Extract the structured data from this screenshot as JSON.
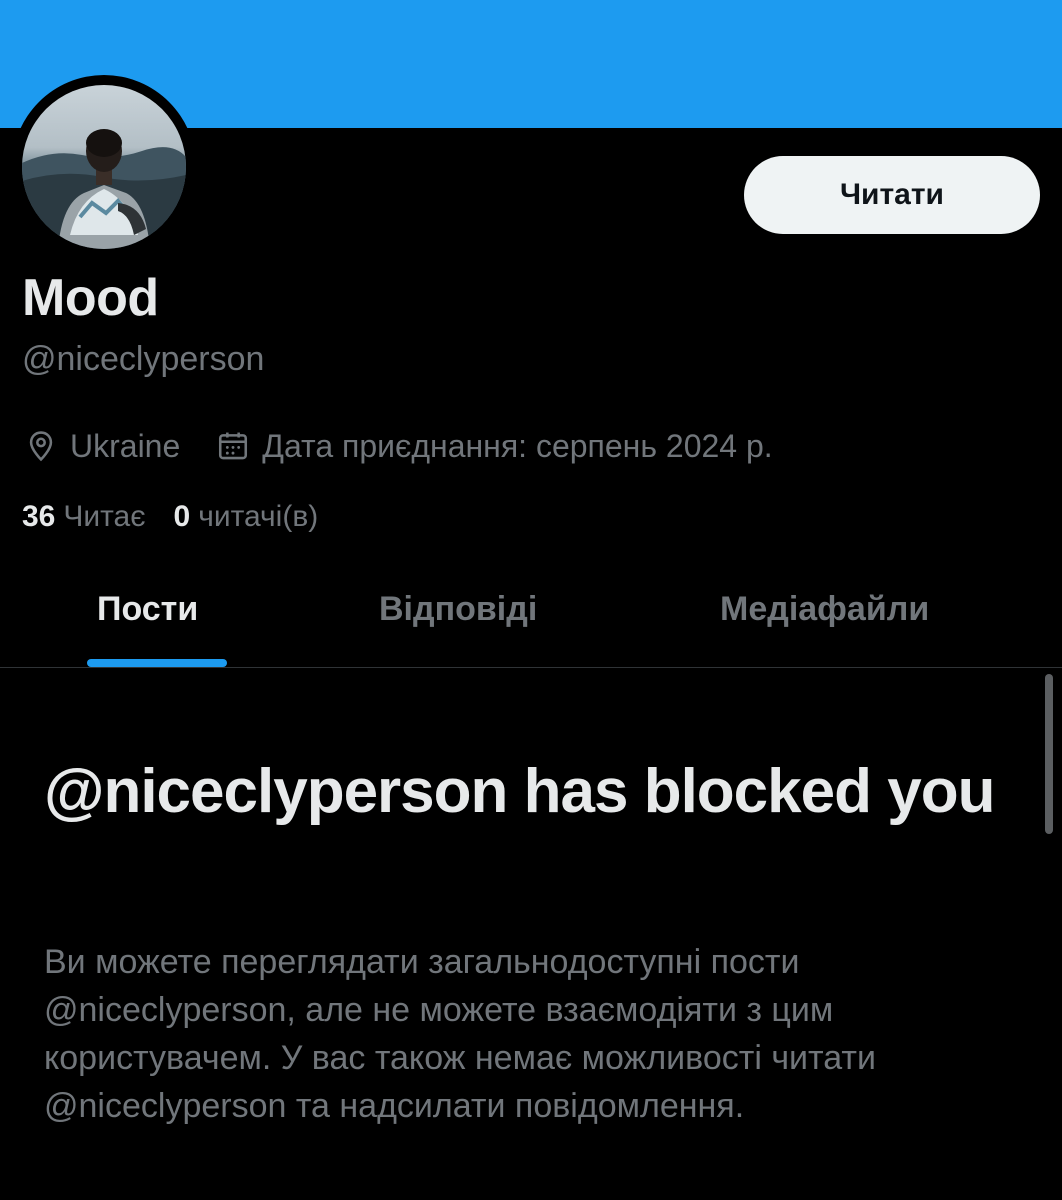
{
  "banner": {
    "color": "#1d9bf0"
  },
  "profile": {
    "display_name": "Mood",
    "handle": "@niceclyperson",
    "location": "Ukraine",
    "joined": "Дата приєднання: серпень 2024 р.",
    "avatar_icon": "profile-photo-person-mountains"
  },
  "actions": {
    "follow_label": "Читати"
  },
  "stats": {
    "following_count": "36",
    "following_label": "Читає",
    "followers_count": "0",
    "followers_label": "читачі(в)"
  },
  "tabs": [
    {
      "label": "Пости",
      "active": true
    },
    {
      "label": "Відповіді",
      "active": false
    },
    {
      "label": "Медіафайли",
      "active": false
    }
  ],
  "blocked": {
    "title": "@niceclyperson has blocked you",
    "description": "Ви можете переглядати загальнодоступні пости @niceclyperson, але не можете взаємодіяти з цим користувачем. У вас також немає можливості читати @niceclyperson та надсилати повідомлення."
  },
  "colors": {
    "accent": "#1d9bf0",
    "background": "#000000",
    "muted_text": "#71767b",
    "primary_text": "#e7e9ea"
  }
}
